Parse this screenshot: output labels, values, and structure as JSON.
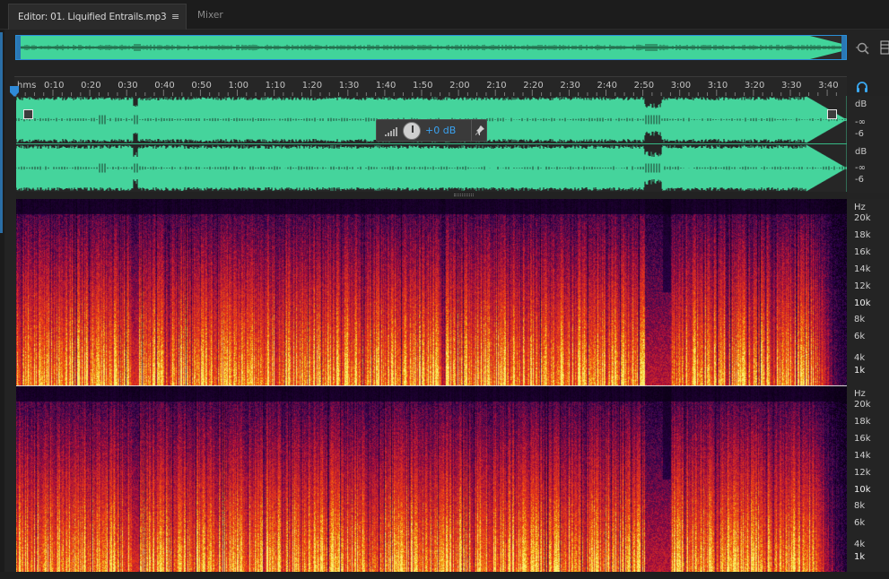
{
  "tabs": {
    "editor_label": "Editor: 01. Liquified Entrails.mp3",
    "menu_glyph": "≡",
    "mixer_label": "Mixer"
  },
  "ruler": {
    "unit": "hms",
    "ticks": [
      "0:10",
      "0:20",
      "0:30",
      "0:40",
      "0:50",
      "1:00",
      "1:10",
      "1:20",
      "1:30",
      "1:40",
      "1:50",
      "2:00",
      "2:10",
      "2:20",
      "2:30",
      "2:40",
      "2:50",
      "3:00",
      "3:10",
      "3:20",
      "3:30",
      "3:40"
    ]
  },
  "hud": {
    "value": "+0 dB",
    "pin_glyph": "📌"
  },
  "db_scale": {
    "channels": [
      [
        "dB",
        "-∞",
        "-6"
      ],
      [
        "dB",
        "-∞",
        "-6"
      ]
    ]
  },
  "hz_scale": {
    "channels": [
      [
        "Hz",
        "20k",
        "18k",
        "16k",
        "14k",
        "12k",
        "10k",
        "8k",
        "6k",
        "4k",
        "1k"
      ],
      [
        "Hz",
        "20k",
        "18k",
        "16k",
        "14k",
        "12k",
        "10k",
        "8k",
        "6k",
        "4k",
        "1k"
      ]
    ]
  },
  "colors": {
    "waveform": "#45d49c",
    "accent": "#2b8fd8"
  },
  "icons": [
    "zoom-icon",
    "panel-icon",
    "playhead-icon",
    "headphone-icon",
    "menu-icon",
    "pin-icon"
  ]
}
